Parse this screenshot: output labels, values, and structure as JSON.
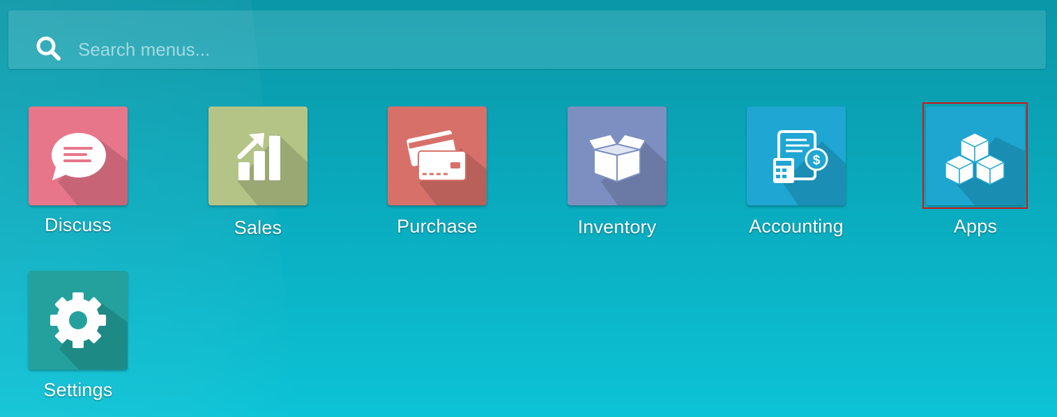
{
  "search": {
    "placeholder": "Search menus...",
    "value": ""
  },
  "apps": [
    {
      "label": "Discuss",
      "color": "#e8768b",
      "icon": "chat-bubble-icon"
    },
    {
      "label": "Sales",
      "color": "#b4c487",
      "icon": "bar-chart-arrow-icon"
    },
    {
      "label": "Purchase",
      "color": "#d8706a",
      "icon": "credit-cards-icon"
    },
    {
      "label": "Inventory",
      "color": "#7c8fc0",
      "icon": "open-box-icon"
    },
    {
      "label": "Accounting",
      "color": "#1fa6d2",
      "icon": "invoice-calculator-icon"
    },
    {
      "label": "Apps",
      "color": "#1ea6d0",
      "icon": "cubes-icon"
    },
    {
      "label": "Settings",
      "color": "#24a19c",
      "icon": "gear-icon"
    }
  ],
  "colors": {
    "highlight": "#d0141c"
  }
}
